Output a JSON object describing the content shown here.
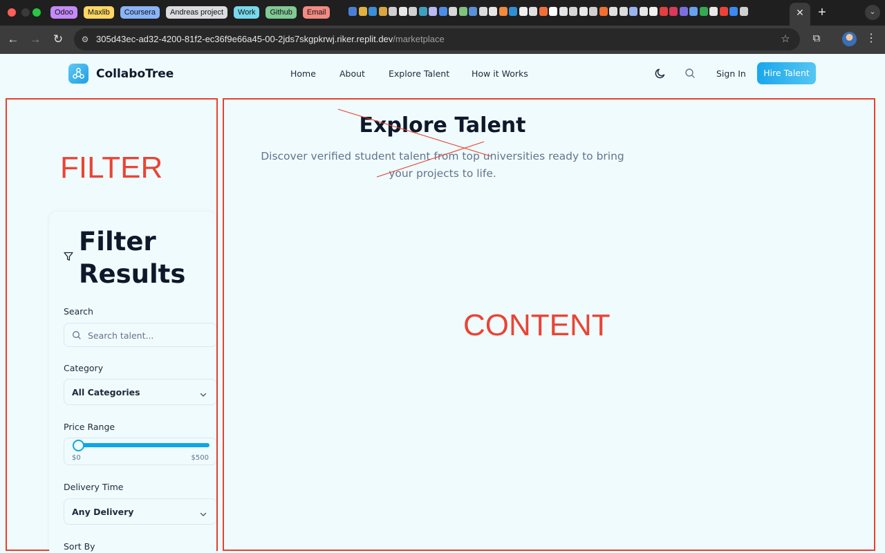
{
  "tab_groups": [
    {
      "label": "Odoo",
      "color": "#c58af9"
    },
    {
      "label": "Maxlib",
      "color": "#fdd663"
    },
    {
      "label": "Coursera",
      "color": "#8ab4f8"
    },
    {
      "label": "Andreas project",
      "color": "#dadce0"
    },
    {
      "label": "Work",
      "color": "#78d9ec"
    },
    {
      "label": "Github",
      "color": "#81c995"
    },
    {
      "label": "Email",
      "color": "#f28b82"
    }
  ],
  "pinned_tab_colors": [
    "#4a7fd6",
    "#e0b040",
    "#3b8ed8",
    "#d9a640",
    "#cfcfcf",
    "#e8e8e8",
    "#d0d0d0",
    "#3f9fbf",
    "#b9b9f5",
    "#4b8ee8",
    "#d8d8d8",
    "#7fc27f",
    "#5a90d8",
    "#dcdcdc",
    "#e6e6e6",
    "#f08a3c",
    "#2f8fd6",
    "#f0f0f0",
    "#e0e0e0",
    "#f26f3a",
    "#ffffff",
    "#e4e4e4",
    "#d6d6d6",
    "#e8e8e8",
    "#d0d0d0",
    "#f07030",
    "#e0e0e0",
    "#dcdcdc",
    "#9ab4f0",
    "#e6e6e6",
    "#f0f0f0",
    "#e04040",
    "#d83a5a",
    "#7b6fe0",
    "#6aa0f0",
    "#34a853",
    "#e8e8e8",
    "#ea4335",
    "#3a8af0",
    "#d0d0d0"
  ],
  "browser": {
    "close_tab_glyph": "✕",
    "new_tab_glyph": "+",
    "tab_menu_glyph": "⌄",
    "url_host": "305d43ec-ad32-4200-81f2-ec36f9e66a45-00-2jds7skgpkrwj.riker.replit.dev",
    "url_path": "/marketplace",
    "back_glyph": "←",
    "forward_glyph": "→",
    "reload_glyph": "↻",
    "site_info_glyph": "⚙",
    "bookmark_glyph": "☆",
    "extensions_glyph": "⧉",
    "menu_glyph": "⋮"
  },
  "header": {
    "brand": "CollaboTree",
    "nav": [
      "Home",
      "About",
      "Explore Talent",
      "How it Works"
    ],
    "sign_in": "Sign In",
    "hire_talent": "Hire Talent"
  },
  "hero": {
    "title": "Explore Talent",
    "subtitle": "Discover verified student talent from top universities ready to bring your projects to life."
  },
  "annotations": {
    "filter": "FILTER",
    "content": "CONTENT",
    "color": "#e8402f"
  },
  "filters": {
    "title": "Filter Results",
    "search_label": "Search",
    "search_placeholder": "Search talent...",
    "category_label": "Category",
    "category_value": "All Categories",
    "price_label": "Price Range",
    "price_min": "$0",
    "price_max": "$500",
    "price_selected": 0,
    "delivery_label": "Delivery Time",
    "delivery_value": "Any Delivery",
    "sort_label": "Sort By"
  },
  "colors": {
    "page_background": "#effbfd",
    "accent": "#0ea5e9",
    "text_primary": "#0f172a",
    "text_muted": "#64748b"
  },
  "icons": {
    "logo": "network-icon",
    "theme_toggle": "moon-icon",
    "header_search": "search-icon",
    "filter": "filter-icon",
    "search_field": "search-icon",
    "select": "chevron-down-icon"
  }
}
